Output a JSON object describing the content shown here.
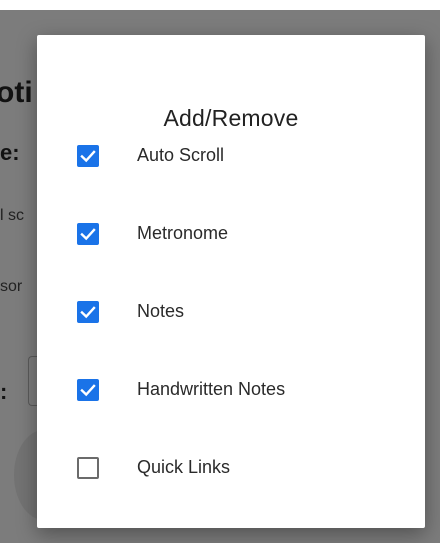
{
  "background": {
    "title_fragment": "oti",
    "label1_fragment": "e:",
    "line1_fragment": "l sc",
    "line2_fragment": "sor",
    "label2_fragment": ":"
  },
  "dialog": {
    "title": "Add/Remove",
    "options": [
      {
        "label": "Auto Scroll",
        "checked": true
      },
      {
        "label": "Metronome",
        "checked": true
      },
      {
        "label": "Notes",
        "checked": true
      },
      {
        "label": "Handwritten Notes",
        "checked": true
      },
      {
        "label": "Quick Links",
        "checked": false
      }
    ]
  },
  "colors": {
    "checkbox_checked": "#1a73e8",
    "scrim": "#7c7c7c"
  }
}
